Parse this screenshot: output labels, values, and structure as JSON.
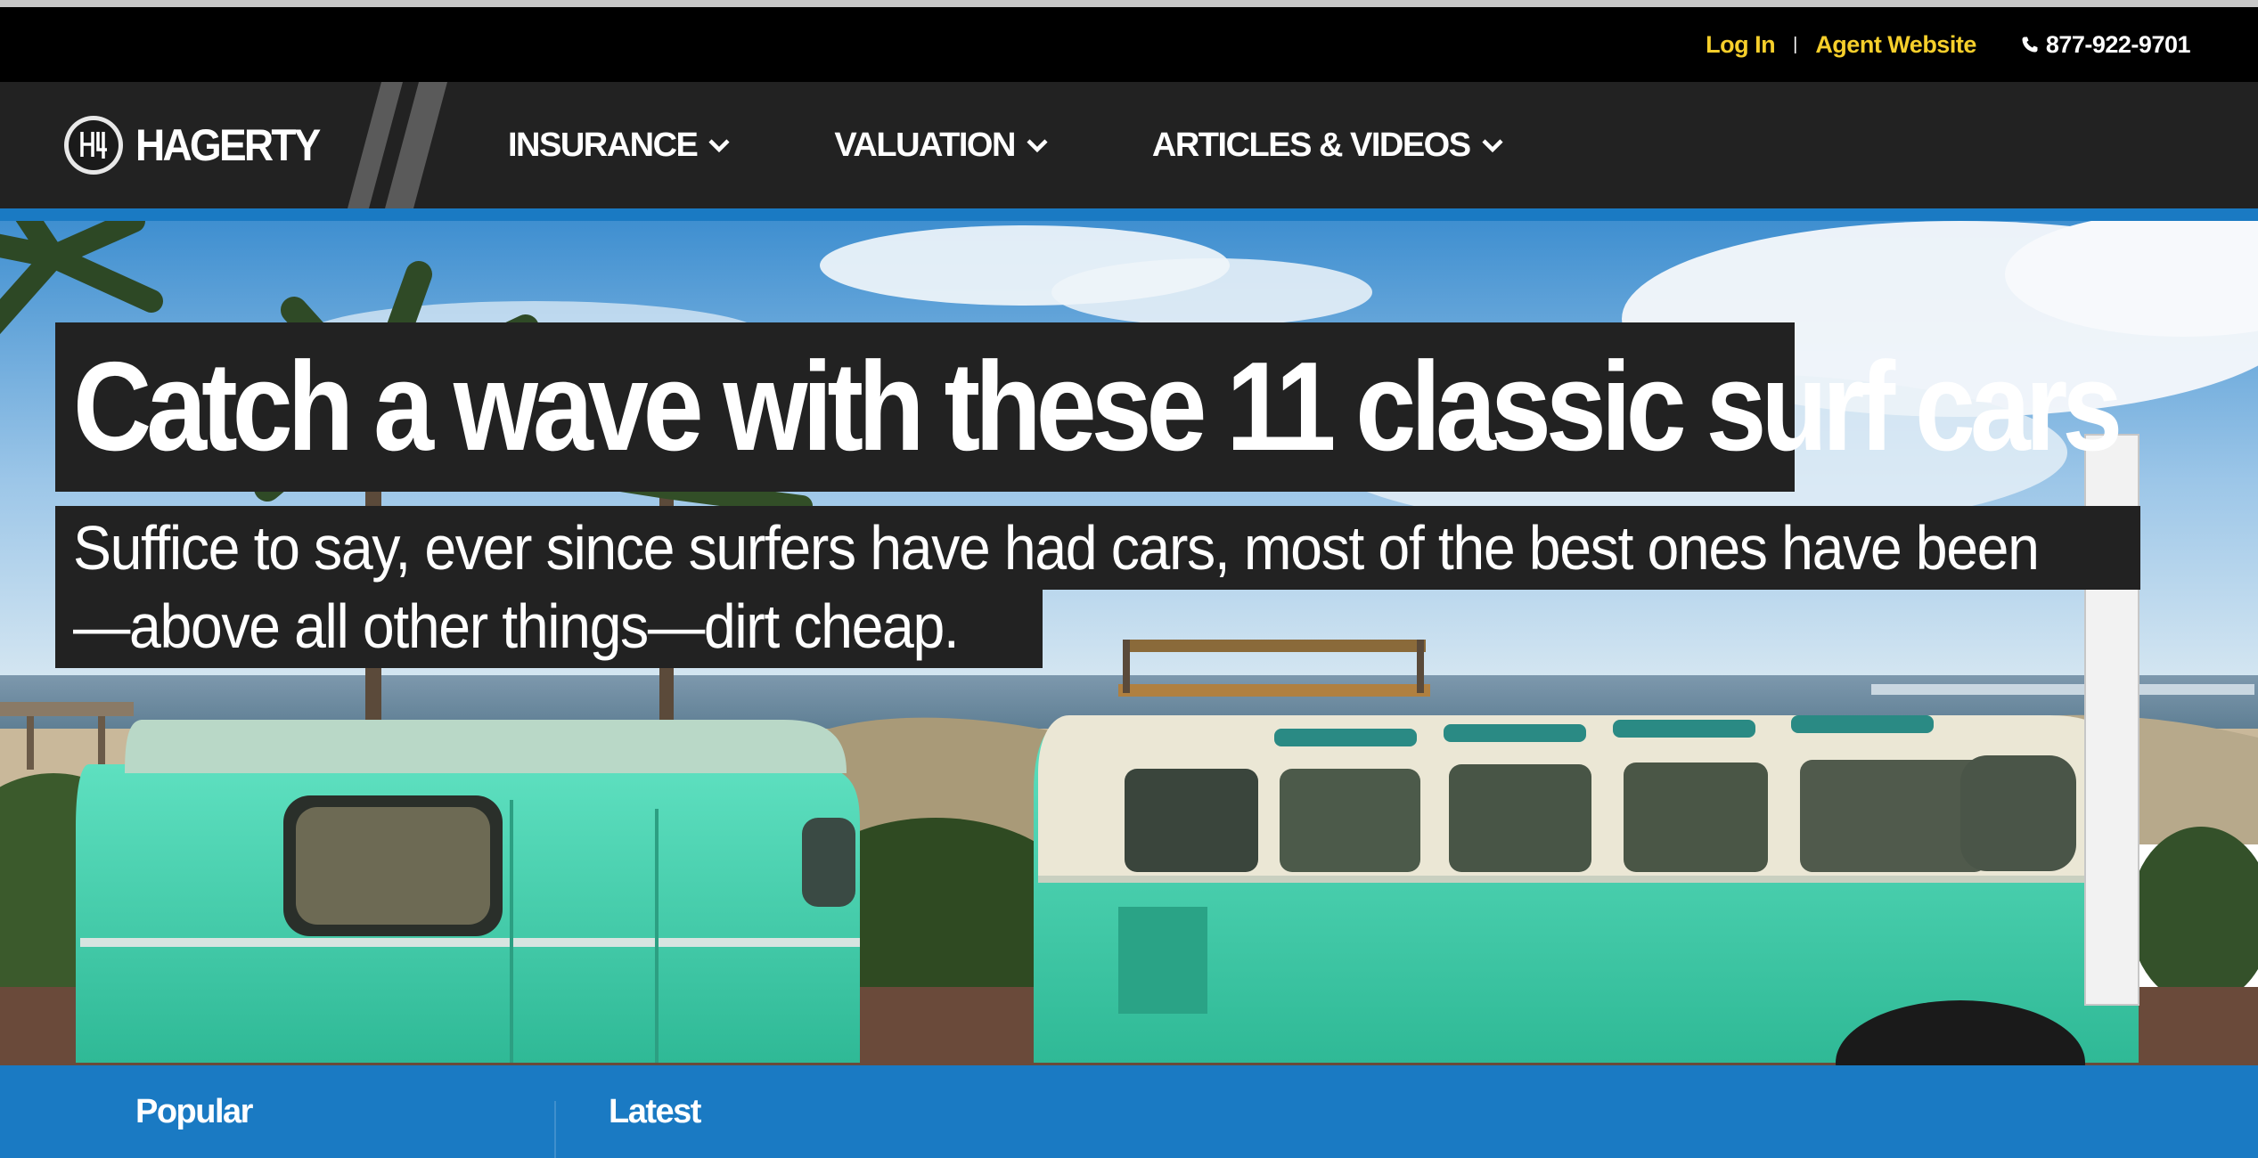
{
  "utility_bar": {
    "login_label": "Log In",
    "separator": "|",
    "agent_label": "Agent Website",
    "phone": "877-922-9701",
    "phone_icon": "phone-icon",
    "link_color": "#f6cf2b"
  },
  "nav": {
    "logo_text": "HAGERTY",
    "logo_mark_text": "H",
    "items": [
      {
        "label": "INSURANCE",
        "icon": "chevron-down-icon"
      },
      {
        "label": "VALUATION",
        "icon": "chevron-down-icon"
      },
      {
        "label": "ARTICLES & VIDEOS",
        "icon": "chevron-down-icon"
      }
    ]
  },
  "hero": {
    "headline": "Catch a wave with these 11 classic surf cars",
    "subhead_line1": "Suffice to say, ever since surfers have had cars, most of the best ones have been",
    "subhead_line2": "—above all other things—dirt cheap."
  },
  "tabs": {
    "items": [
      {
        "label": "Popular"
      },
      {
        "label": "Latest"
      }
    ]
  },
  "colors": {
    "accent_blue": "#1a7ac3",
    "nav_bg": "#222222",
    "utility_bg": "#000000"
  }
}
